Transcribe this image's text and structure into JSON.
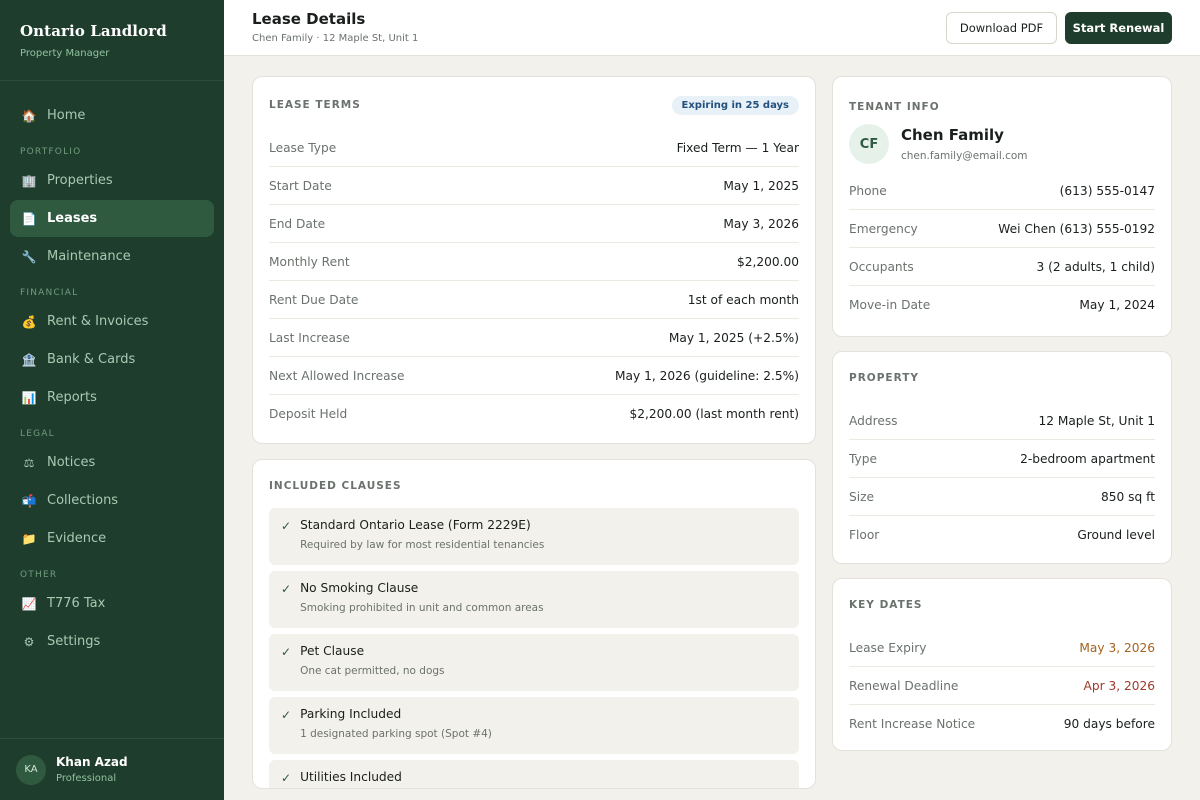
{
  "sidebar": {
    "brand_title": "Ontario Landlord",
    "brand_sub": "Property Manager",
    "home": {
      "label": "Home",
      "icon": "🏠"
    },
    "sections": {
      "portfolio": "PORTFOLIO",
      "financial": "FINANCIAL",
      "legal": "LEGAL",
      "other": "OTHER"
    },
    "portfolio_items": [
      {
        "label": "Properties",
        "icon": "🏢"
      },
      {
        "label": "Leases",
        "icon": "📄",
        "active": true
      },
      {
        "label": "Maintenance",
        "icon": "🔧"
      }
    ],
    "financial_items": [
      {
        "label": "Rent & Invoices",
        "icon": "💰"
      },
      {
        "label": "Bank & Cards",
        "icon": "🏦"
      },
      {
        "label": "Reports",
        "icon": "📊"
      }
    ],
    "legal_items": [
      {
        "label": "Notices",
        "icon": "⚖"
      },
      {
        "label": "Collections",
        "icon": "📬"
      },
      {
        "label": "Evidence",
        "icon": "📁"
      }
    ],
    "other_items": [
      {
        "label": "T776 Tax",
        "icon": "📈"
      },
      {
        "label": "Settings",
        "icon": "⚙"
      }
    ],
    "user": {
      "initials": "KA",
      "name": "Khan Azad",
      "role": "Professional"
    }
  },
  "header": {
    "title": "Lease Details",
    "subtitle": "Chen Family · 12 Maple St, Unit 1",
    "download_label": "Download PDF",
    "renewal_label": "Start Renewal"
  },
  "lease_terms": {
    "title": "LEASE TERMS",
    "badge": "Expiring in 25 days",
    "rows": [
      {
        "k": "Lease Type",
        "v": "Fixed Term — 1 Year"
      },
      {
        "k": "Start Date",
        "v": "May 1, 2025"
      },
      {
        "k": "End Date",
        "v": "May 3, 2026"
      },
      {
        "k": "Monthly Rent",
        "v": "$2,200.00"
      },
      {
        "k": "Rent Due Date",
        "v": "1st of each month"
      },
      {
        "k": "Last Increase",
        "v": "May 1, 2025 (+2.5%)"
      },
      {
        "k": "Next Allowed Increase",
        "v": "May 1, 2026 (guideline: 2.5%)"
      },
      {
        "k": "Deposit Held",
        "v": "$2,200.00 (last month rent)"
      }
    ]
  },
  "clauses": {
    "title": "INCLUDED CLAUSES",
    "check": "✓",
    "items": [
      {
        "title": "Standard Ontario Lease (Form 2229E)",
        "desc": "Required by law for most residential tenancies"
      },
      {
        "title": "No Smoking Clause",
        "desc": "Smoking prohibited in unit and common areas"
      },
      {
        "title": "Pet Clause",
        "desc": "One cat permitted, no dogs"
      },
      {
        "title": "Parking Included",
        "desc": "1 designated parking spot (Spot #4)"
      },
      {
        "title": "Utilities Included",
        "desc": ""
      }
    ]
  },
  "tenant": {
    "title": "TENANT INFO",
    "initials": "CF",
    "name": "Chen Family",
    "email": "chen.family@email.com",
    "rows": [
      {
        "k": "Phone",
        "v": "(613) 555-0147"
      },
      {
        "k": "Emergency",
        "v": "Wei Chen (613) 555-0192"
      },
      {
        "k": "Occupants",
        "v": "3 (2 adults, 1 child)"
      },
      {
        "k": "Move-in Date",
        "v": "May 1, 2024"
      }
    ]
  },
  "property": {
    "title": "PROPERTY",
    "rows": [
      {
        "k": "Address",
        "v": "12 Maple St, Unit 1"
      },
      {
        "k": "Type",
        "v": "2-bedroom apartment"
      },
      {
        "k": "Size",
        "v": "850 sq ft"
      },
      {
        "k": "Floor",
        "v": "Ground level"
      }
    ]
  },
  "key_dates": {
    "title": "KEY DATES",
    "rows": [
      {
        "k": "Lease Expiry",
        "v": "May 3, 2026"
      },
      {
        "k": "Renewal Deadline",
        "v": "Apr 3, 2026"
      },
      {
        "k": "Rent Increase Notice",
        "v": "90 days before"
      }
    ],
    "colors": {
      "expiry": "#a6621d",
      "deadline": "#a03a2a"
    }
  },
  "colors": {
    "sidebar_bg": "#1f3d2c",
    "accent": "#2f5a40",
    "badge_bg": "#e8f0f8",
    "badge_text": "#23507e"
  }
}
